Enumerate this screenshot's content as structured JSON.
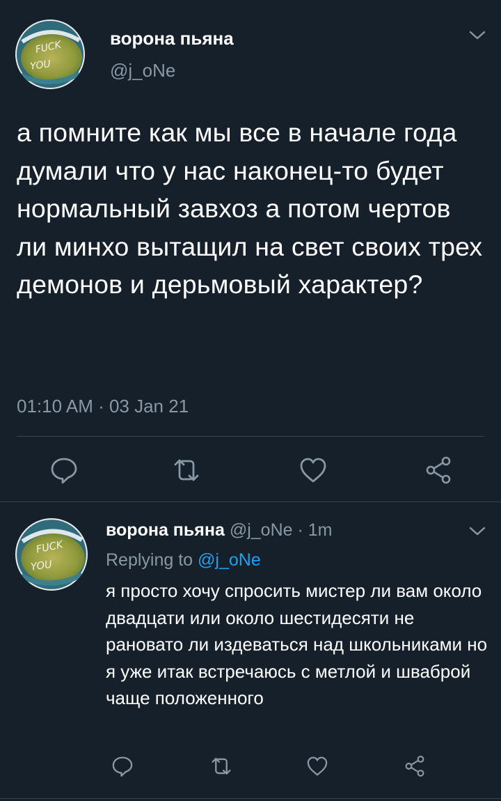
{
  "main_tweet": {
    "display_name": "ворона пьяна",
    "handle": "@j_oNe",
    "text": "а помните как мы все в начале года думали что у нас наконец-то будет нормальный завхоз а потом чертов ли минхо вытащил на свет своих трех демонов и дерьмовый характер?",
    "timestamp": "01:10 AM · 03 Jan 21",
    "avatar_text_top": "FUCK",
    "avatar_text_bottom": "YOU"
  },
  "reply_tweet": {
    "display_name": "ворона пьяна",
    "handle": "@j_oNe",
    "time_separator": "·",
    "time": "1m",
    "replying_to_label": "Replying to",
    "replying_to_handle": "@j_oNe",
    "text": "я просто хочу спросить мистер ли вам около двадцати или около шестидесяти не рановато ли издеваться над школьниками но я уже итак встречаюсь с метлой и шваброй чаще положенного",
    "avatar_text_top": "FUCK",
    "avatar_text_bottom": "YOU"
  },
  "icons": {
    "reply": "reply-icon",
    "retweet": "retweet-icon",
    "like": "heart-icon",
    "share": "share-icon",
    "chevron": "chevron-down-icon"
  },
  "colors": {
    "background": "#15202b",
    "text": "#ffffff",
    "muted": "#8899a6",
    "link": "#1da1f2",
    "divider": "#38444d"
  }
}
